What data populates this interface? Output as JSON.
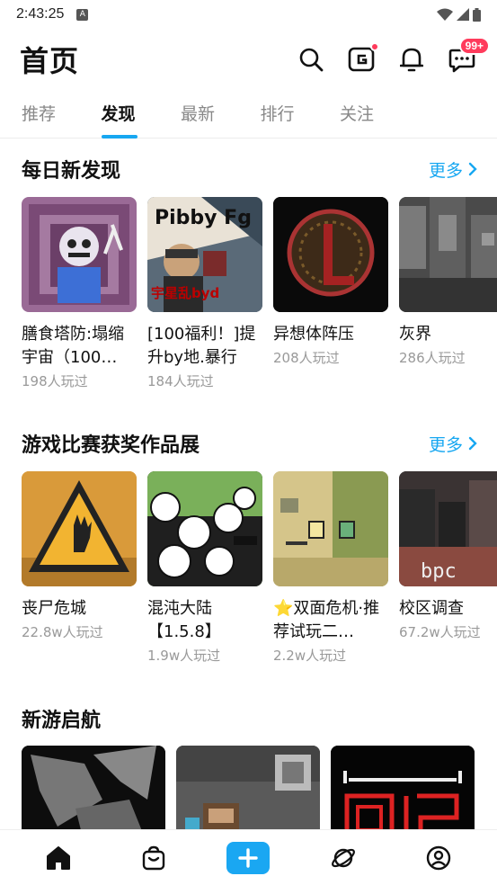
{
  "status": {
    "time": "2:43:25",
    "a_icon": "A"
  },
  "header": {
    "title": "首页",
    "badge": "99+"
  },
  "tabs": [
    {
      "label": "推荐"
    },
    {
      "label": "发现"
    },
    {
      "label": "最新"
    },
    {
      "label": "排行"
    },
    {
      "label": "关注"
    }
  ],
  "sections": {
    "daily": {
      "title": "每日新发现",
      "more": "更多",
      "games": [
        {
          "name": "膳食塔防:塌缩宇宙（100…",
          "plays": "198人玩过"
        },
        {
          "name": "[100福利！]提升by地.暴行",
          "plays": "184人玩过"
        },
        {
          "name": "异想体阵压",
          "plays": "208人玩过"
        },
        {
          "name": "灰界",
          "plays": "286人玩过"
        }
      ]
    },
    "contest": {
      "title": "游戏比赛获奖作品展",
      "more": "更多",
      "games": [
        {
          "name": "丧尸危城",
          "plays": "22.8w人玩过"
        },
        {
          "name": "混沌大陆【1.5.8】",
          "plays": "1.9w人玩过"
        },
        {
          "name": "⭐双面危机·推荐试玩二…",
          "plays": "2.2w人玩过"
        },
        {
          "name": "校区调查",
          "plays": "67.2w人玩过"
        }
      ]
    },
    "newgames": {
      "title": "新游启航"
    }
  },
  "thumb_text": {
    "pibby": "Pibby Fg",
    "pibby_sub": "宇星乱byd",
    "campus": "bpc"
  },
  "nav": [
    "home-icon",
    "shop-bag-icon",
    "create-plus-icon",
    "planet-icon",
    "profile-icon"
  ],
  "colors": {
    "accent": "#17a7f1",
    "badge": "#ff3b5c"
  }
}
